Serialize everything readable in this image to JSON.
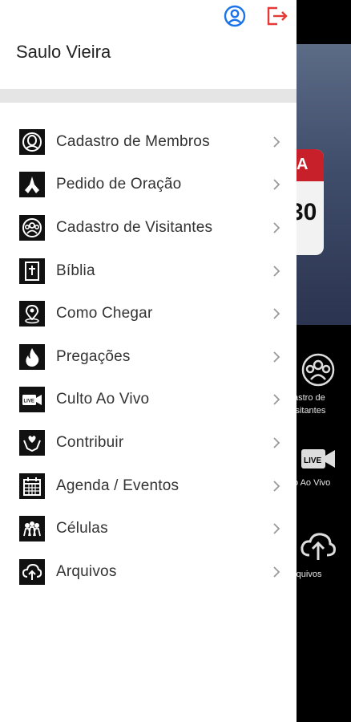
{
  "user": {
    "name": "Saulo Vieira"
  },
  "header_icons": {
    "profile": "user-circle-icon",
    "logout": "logout-icon"
  },
  "menu": [
    {
      "label": "Cadastro de Membros",
      "icon": "member-face-icon"
    },
    {
      "label": "Pedido de Oração",
      "icon": "praying-hands-icon"
    },
    {
      "label": "Cadastro de Visitantes",
      "icon": "visitors-group-icon"
    },
    {
      "label": "Bíblia",
      "icon": "bible-icon"
    },
    {
      "label": "Como Chegar",
      "icon": "map-pin-icon"
    },
    {
      "label": "Pregações",
      "icon": "fire-icon"
    },
    {
      "label": "Culto Ao Vivo",
      "icon": "live-video-icon"
    },
    {
      "label": "Contribuir",
      "icon": "giving-hands-heart-icon"
    },
    {
      "label": "Agenda / Eventos",
      "icon": "calendar-icon"
    },
    {
      "label": "Células",
      "icon": "cell-group-icon"
    },
    {
      "label": "Arquivos",
      "icon": "cloud-upload-icon"
    }
  ],
  "background": {
    "card_letter": "A",
    "card_number": "30",
    "tiles": [
      {
        "line1": "astro de",
        "line2": "isitantes"
      },
      {
        "line1": "o Ao Vivo"
      },
      {
        "line1": "rquivos"
      }
    ]
  },
  "colors": {
    "profile": "#1a73e8",
    "logout": "#e53935",
    "drawer_bg": "#ffffff",
    "divider": "#e5e5e5"
  }
}
